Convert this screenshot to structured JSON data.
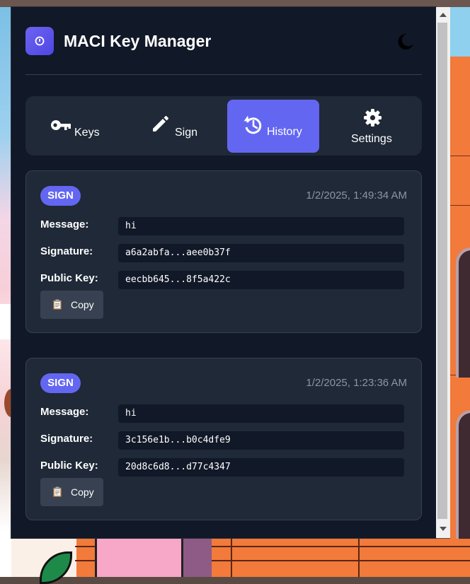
{
  "app": {
    "title": "MACI Key Manager"
  },
  "tabs": [
    {
      "label": "Keys",
      "icon": "key-icon",
      "active": false
    },
    {
      "label": "Sign",
      "icon": "pencil-icon",
      "active": false
    },
    {
      "label": "History",
      "icon": "history-icon",
      "active": true
    },
    {
      "label": "Settings",
      "icon": "gear-icon",
      "active": false
    }
  ],
  "history": [
    {
      "type": "SIGN",
      "timestamp": "1/2/2025, 1:49:34 AM",
      "message_label": "Message:",
      "message": "hi",
      "signature_label": "Signature:",
      "signature": "a6a2abfa...aee0b37f",
      "public_key_label": "Public Key:",
      "public_key": "eecbb645...8f5a422c",
      "copy_label": "Copy"
    },
    {
      "type": "SIGN",
      "timestamp": "1/2/2025, 1:23:36 AM",
      "message_label": "Message:",
      "message": "hi",
      "signature_label": "Signature:",
      "signature": "3c156e1b...b0c4dfe9",
      "public_key_label": "Public Key:",
      "public_key": "20d8c6d8...d77c4347",
      "copy_label": "Copy"
    }
  ],
  "colors": {
    "accent": "#6366f1",
    "panel": "#1f2937",
    "background": "#111827",
    "muted_text": "#8b95a5"
  }
}
